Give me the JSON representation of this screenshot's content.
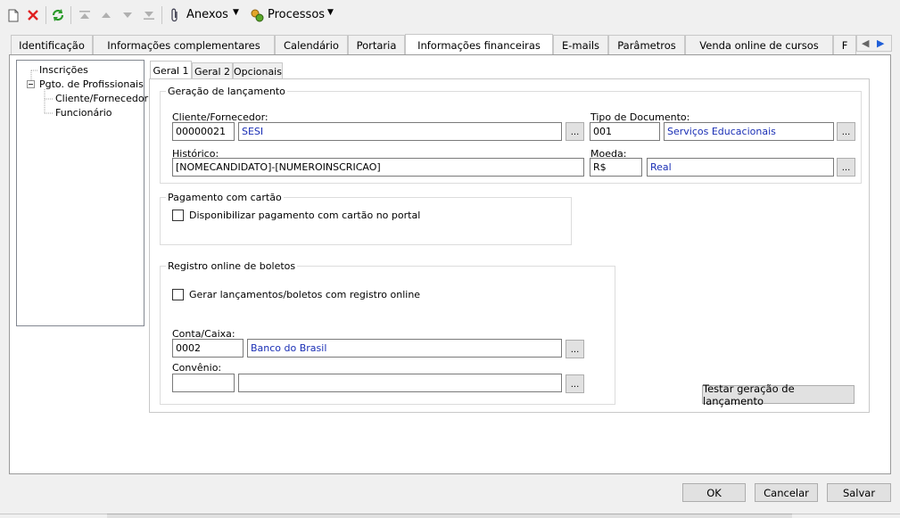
{
  "toolbar": {
    "anexos_label": "Anexos",
    "processos_label": "Processos"
  },
  "tabs": [
    {
      "label": "Identificação"
    },
    {
      "label": "Informações complementares"
    },
    {
      "label": "Calendário"
    },
    {
      "label": "Portaria"
    },
    {
      "label": "Informações financeiras"
    },
    {
      "label": "E-mails"
    },
    {
      "label": "Parâmetros"
    },
    {
      "label": "Venda online de cursos"
    },
    {
      "label": "F"
    }
  ],
  "tree": {
    "items": [
      {
        "label": "Inscrições"
      },
      {
        "label": "Pgto. de Profissionais"
      },
      {
        "label": "Cliente/Fornecedor"
      },
      {
        "label": "Funcionário"
      }
    ]
  },
  "subtabs": [
    {
      "label": "Geral 1"
    },
    {
      "label": "Geral 2"
    },
    {
      "label": "Opcionais"
    }
  ],
  "geracao": {
    "legend": "Geração de lançamento",
    "cliente_label": "Cliente/Fornecedor:",
    "cliente_code": "00000021",
    "cliente_name": "SESI",
    "tipo_label": "Tipo de Documento:",
    "tipo_code": "001",
    "tipo_name": "Serviços Educacionais",
    "historico_label": "Histórico:",
    "historico_value": "[NOMECANDIDATO]-[NUMEROINSCRICAO]",
    "moeda_label": "Moeda:",
    "moeda_code": "R$",
    "moeda_name": "Real",
    "dots": "..."
  },
  "cartao": {
    "legend": "Pagamento com cartão",
    "checkbox_label": "Disponibilizar pagamento com cartão no portal"
  },
  "registro": {
    "legend": "Registro online de boletos",
    "checkbox_label": "Gerar lançamentos/boletos com registro online",
    "conta_label": "Conta/Caixa:",
    "conta_code": "0002",
    "conta_name": "Banco do Brasil",
    "convenio_label": "Convênio:",
    "convenio_code": "",
    "convenio_name": ""
  },
  "testar_label": "Testar geração de lançamento",
  "footer": {
    "ok_label": "OK",
    "cancel_label": "Cancelar",
    "save_label": "Salvar"
  }
}
